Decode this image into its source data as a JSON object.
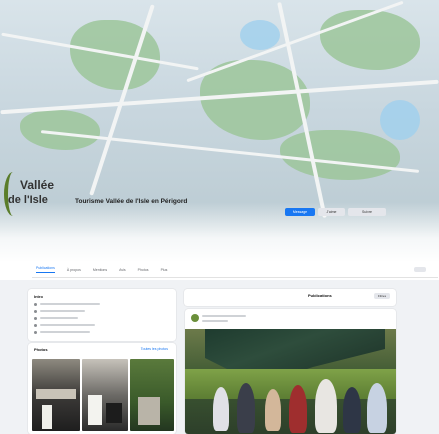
{
  "page": {
    "name": "Tourisme Vallée de l'Isle en Périgord",
    "logo": {
      "line1": "Vallée",
      "line2": "de l'Isle"
    }
  },
  "header_buttons": {
    "primary": "Message",
    "secondary_1": "J'aime",
    "secondary_2": "Suivre"
  },
  "tabs": [
    {
      "label": "Publications",
      "active": true
    },
    {
      "label": "À propos",
      "active": false
    },
    {
      "label": "Mentions",
      "active": false
    },
    {
      "label": "Avis",
      "active": false
    },
    {
      "label": "Photos",
      "active": false
    },
    {
      "label": "Plus",
      "active": false
    }
  ],
  "intro": {
    "title": "Intro"
  },
  "photos": {
    "title": "Photos",
    "link": "Toutes les photos"
  },
  "posts": {
    "title": "Publications",
    "filters": "Filtres"
  },
  "colors": {
    "accent": "#1877f2",
    "brand_green": "#5a7d2a"
  }
}
